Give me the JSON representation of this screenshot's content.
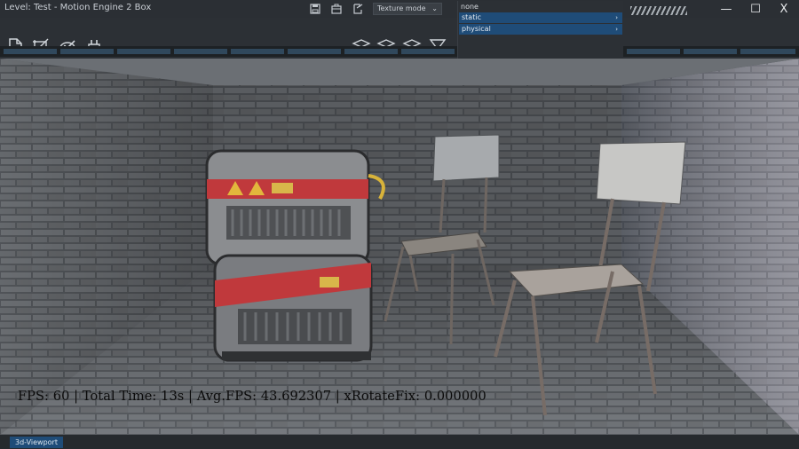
{
  "window": {
    "title": "Level: Test - Motion Engine 2 Box",
    "minimize_glyph": "—",
    "maximize_glyph": "☐",
    "close_glyph": "X"
  },
  "toolbar": {
    "render_mode": "Texture mode",
    "file_tools": [
      "new-file-icon",
      "transform-icon",
      "paint-icon",
      "plug-icon"
    ],
    "layer_tools": [
      "layers-icon",
      "layers-icon",
      "layers-icon",
      "filter-icon"
    ],
    "title_icons": [
      "save-icon",
      "briefcase-icon",
      "export-icon"
    ]
  },
  "dropdown": {
    "none_label": "none",
    "items": [
      {
        "label": "static"
      },
      {
        "label": "physical"
      }
    ]
  },
  "viewport": {
    "overlay_text": "FPS: 60 | Total Time: 13s | Avg.FPS: 43.692307 | xRotateFix: 0.000000"
  },
  "statusbar": {
    "tab_label": "3d-Viewport"
  },
  "colors": {
    "accent": "#1f4c78",
    "window_bg": "#2b2f34"
  }
}
